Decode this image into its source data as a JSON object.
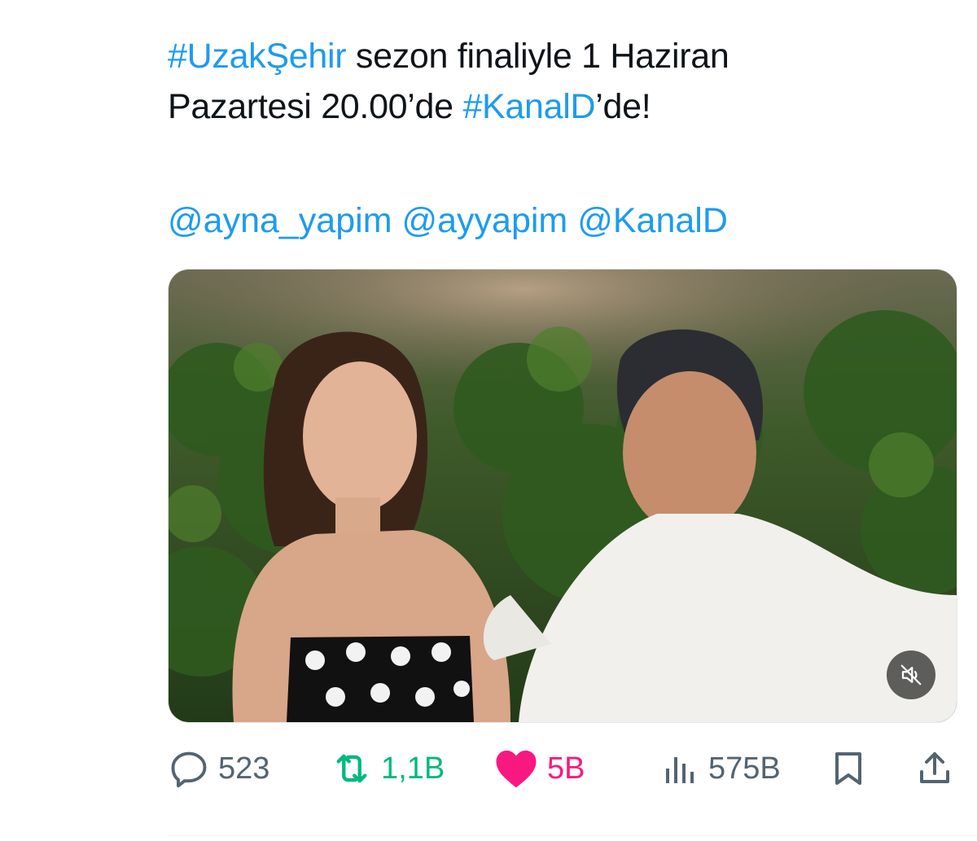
{
  "tweet": {
    "line1_hashtag": "#UzakŞehir",
    "line1_text": " sezon finaliyle 1 Haziran",
    "line2_text": "Pazartesi 20.00’de ",
    "line2_hashtag": "#KanalD",
    "line2_suffix": "’de!",
    "mentions": [
      "@ayna_yapim",
      "@ayyapim",
      "@KanalD"
    ]
  },
  "media": {
    "type": "video",
    "mute_icon": "speaker-muted-icon"
  },
  "actions": {
    "reply": {
      "icon": "reply-icon",
      "count": "523"
    },
    "retweet": {
      "icon": "retweet-icon",
      "count": "1,1B"
    },
    "like": {
      "icon": "heart-filled-icon",
      "count": "5B"
    },
    "views": {
      "icon": "views-chart-icon",
      "count": "575B"
    },
    "bookmark": {
      "icon": "bookmark-icon"
    },
    "share": {
      "icon": "share-icon"
    }
  },
  "colors": {
    "link": "#1d9bf0",
    "text": "#0f1419",
    "muted": "#536471",
    "retweet": "#00ba7c",
    "like": "#f91880"
  }
}
